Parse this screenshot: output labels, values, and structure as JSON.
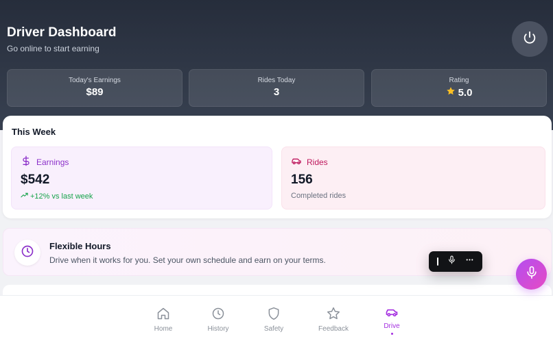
{
  "header": {
    "title": "Driver Dashboard",
    "subtitle": "Go online to start earning"
  },
  "stats": [
    {
      "label": "Today's Earnings",
      "value": "$89"
    },
    {
      "label": "Rides Today",
      "value": "3"
    },
    {
      "label": "Rating",
      "value": "5.0",
      "icon": "star-icon"
    }
  ],
  "week": {
    "title": "This Week",
    "earnings": {
      "label": "Earnings",
      "value": "$542",
      "sub": "+12% vs last week",
      "icon": "dollar-icon"
    },
    "rides": {
      "label": "Rides",
      "value": "156",
      "sub": "Completed rides",
      "icon": "car-icon"
    }
  },
  "flexible": {
    "title": "Flexible Hours",
    "description": "Drive when it works for you. Set your own schedule and earn on your terms.",
    "icon": "clock-icon"
  },
  "nav": {
    "items": [
      {
        "label": "Home",
        "icon": "home-icon"
      },
      {
        "label": "History",
        "icon": "clock-icon"
      },
      {
        "label": "Safety",
        "icon": "shield-icon"
      },
      {
        "label": "Feedback",
        "icon": "star-icon"
      },
      {
        "label": "Drive",
        "icon": "car-icon",
        "active": true
      }
    ]
  },
  "colors": {
    "accent": "#a42ee0",
    "header_bg": "#262d3b",
    "earnings_accent": "#8b2fc9",
    "rides_accent": "#be185d",
    "positive": "#16a34a",
    "star": "#fbbf24"
  }
}
